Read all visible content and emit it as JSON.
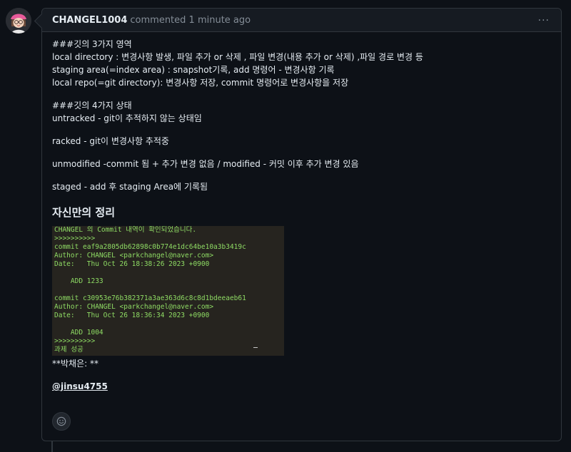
{
  "comment": {
    "author": "CHANGEL1004",
    "meta": "commented 1 minute ago",
    "menu_glyph": "···"
  },
  "body": {
    "section1": {
      "title": "###깃의 3가지 영역",
      "lines": [
        "local directory : 변경사항 발생, 파일 추가 or 삭제 , 파일 변경(내용 추가 or 삭제) ,파일 경로 변경 등",
        "staging area(=index area) : snapshot기록, add 명령어 - 변경사항 기록",
        "local repo(=git directory): 변경사항 저장, commit 명령어로 변경사항을 저장"
      ]
    },
    "section2": {
      "title": "###깃의 4가지 상태",
      "line": "untracked - git이 추적하지 않는 상태임"
    },
    "p_racked": "racked - git이 변경사항 추적중",
    "p_unmodified": "unmodified -commit 됨 + 추가 변경 없음 / modified - 커밋 이후 추가 변경 있음",
    "p_staged": "staged - add 후 staging Area에 기록됨",
    "heading": "자신만의 정리",
    "terminal_lines": [
      "CHANGEL 의 Commit 내역이 확인되었습니다.",
      ">>>>>>>>>>",
      "commit eaf9a2805db62898c0b774e1dc64be10a3b3419c",
      "Author: CHANGEL <parkchangel@naver.com>",
      "Date:   Thu Oct 26 18:38:26 2023 +0900",
      "",
      "    ADD 1233",
      "",
      "commit c30953e76b382371a3ae363d6c8c8d1bdeeaeb61",
      "Author: CHANGEL <parkchangel@naver.com>",
      "Date:   Thu Oct 26 18:36:34 2023 +0900",
      "",
      "    ADD 1004",
      ">>>>>>>>>>",
      "과제 성공"
    ],
    "bold_line": "**박채은: **",
    "mention": "@jinsu4755"
  },
  "icons": {
    "avatar": "user-avatar",
    "menu": "kebab-icon",
    "reaction": "smiley-icon"
  },
  "colors": {
    "background": "#0d1117",
    "header": "#161b22",
    "border": "#30363d",
    "terminal_bg": "#26241f",
    "terminal_text": "#8fdc64"
  }
}
